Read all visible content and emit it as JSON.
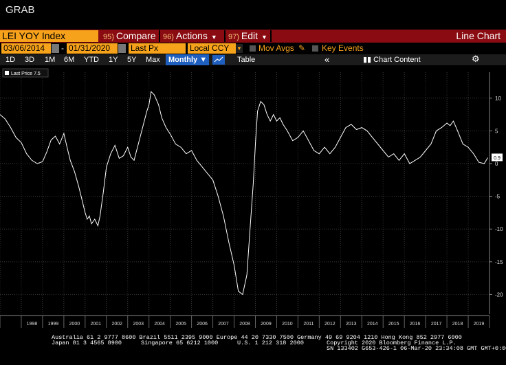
{
  "window_title": "GRAB",
  "toolbar": {
    "ticker": "LEI YOY Index",
    "compare_num": "95)",
    "compare": "Compare",
    "actions_num": "96)",
    "actions": "Actions",
    "edit_num": "97)",
    "edit": "Edit",
    "chart_type": "Line Chart"
  },
  "settings": {
    "start_date": "03/06/2014",
    "end_date": "01/31/2020",
    "dash": "-",
    "field": "Last Px",
    "currency": "Local CCY",
    "mov_avgs": "Mov Avgs",
    "key_events": "Key Events"
  },
  "periods": [
    "1D",
    "3D",
    "1M",
    "6M",
    "YTD",
    "1Y",
    "5Y",
    "Max"
  ],
  "frequency": "Monthly",
  "table_label": "Table",
  "chart_content": "Chart Content",
  "footer": {
    "line1": "Australia 61 2 9777 8600 Brazil 5511 2395 9000 Europe 44 20 7330 7500 Germany 49 69 9204 1210 Hong Kong 852 2977 6000",
    "line2a": "Japan 81 3 4565 8900",
    "line2b": "Singapore 65 6212 1000",
    "line2c": "U.S. 1 212 318 2000",
    "line2d": "Copyright 2020 Bloomberg Finance L.P.",
    "line3": "SN 133402 G653-426-1 06-Mar-20 23:34:08 GMT  GMT+0:00"
  },
  "colors": {
    "accent": "#f7a21b",
    "menu_bar": "#8a0c12",
    "line": "#ffffff",
    "background": "#000000"
  },
  "chart_data": {
    "type": "line",
    "legend": "Last Price 7.5",
    "last_value_label": "0.9",
    "xlabel": "",
    "ylabel": "",
    "ylim": [
      -23,
      12.5
    ],
    "yticks": [
      -20,
      -15,
      -10,
      -5,
      0,
      5,
      10
    ],
    "grid": true,
    "x_ticks": [
      "1998",
      "1999",
      "2000",
      "2001",
      "2002",
      "2003",
      "2004",
      "2005",
      "2006",
      "2007",
      "2008",
      "2009",
      "2010",
      "2011",
      "2012",
      "2013",
      "2014",
      "2015",
      "2016",
      "2017",
      "2018",
      "2019"
    ],
    "series": [
      {
        "x": [
          1997.0,
          1997.25,
          1997.5,
          1997.75,
          1998.0,
          1998.25,
          1998.5,
          1998.75,
          1999.0,
          1999.2,
          1999.4,
          1999.6,
          1999.8,
          2000.0,
          2000.15,
          2000.3,
          2000.5,
          2000.7,
          2000.85,
          2001.0,
          2001.1,
          2001.2,
          2001.3,
          2001.45,
          2001.6,
          2001.7,
          2001.85,
          2002.0,
          2002.2,
          2002.4,
          2002.6,
          2002.8,
          2003.0,
          2003.15,
          2003.3,
          2003.5,
          2003.7,
          2003.9,
          2004.0,
          2004.1,
          2004.25,
          2004.45,
          2004.6,
          2004.8,
          2005.0,
          2005.25,
          2005.5,
          2005.75,
          2006.0,
          2006.25,
          2006.5,
          2006.75,
          2007.0,
          2007.25,
          2007.5,
          2007.75,
          2008.0,
          2008.2,
          2008.4,
          2008.6,
          2008.75,
          2008.9,
          2009.0,
          2009.1,
          2009.25,
          2009.4,
          2009.55,
          2009.7,
          2009.85,
          2010.0,
          2010.15,
          2010.3,
          2010.5,
          2010.75,
          2011.0,
          2011.25,
          2011.5,
          2011.75,
          2012.0,
          2012.25,
          2012.5,
          2012.75,
          2013.0,
          2013.25,
          2013.5,
          2013.75,
          2014.0,
          2014.25,
          2014.5,
          2014.75,
          2015.0,
          2015.25,
          2015.5,
          2015.75,
          2016.0,
          2016.25,
          2016.5,
          2016.75,
          2017.0,
          2017.25,
          2017.5,
          2017.75,
          2018.0,
          2018.15,
          2018.3,
          2018.5,
          2018.75,
          2019.0,
          2019.25,
          2019.5,
          2019.75,
          2019.92
        ],
        "y": [
          7.5,
          6.8,
          5.5,
          4.0,
          3.2,
          1.5,
          0.5,
          0.0,
          0.3,
          1.8,
          3.6,
          4.2,
          3.0,
          4.6,
          2.5,
          0.5,
          -1.2,
          -3.5,
          -5.5,
          -7.5,
          -8.5,
          -8.0,
          -9.2,
          -8.5,
          -9.5,
          -8.0,
          -4.5,
          -0.5,
          1.5,
          2.8,
          0.8,
          1.2,
          2.5,
          1.0,
          0.5,
          3.0,
          5.5,
          8.0,
          9.0,
          11.0,
          10.5,
          9.0,
          7.0,
          5.5,
          4.5,
          3.0,
          2.5,
          1.5,
          2.0,
          0.5,
          -0.5,
          -1.5,
          -2.5,
          -5.0,
          -8.0,
          -12.0,
          -15.5,
          -19.5,
          -20.0,
          -17.0,
          -10.0,
          -3.0,
          3.0,
          8.0,
          9.5,
          9.0,
          7.5,
          6.5,
          7.5,
          6.5,
          7.0,
          6.0,
          5.0,
          3.5,
          4.0,
          5.0,
          3.5,
          2.0,
          1.5,
          2.5,
          1.5,
          2.5,
          4.0,
          5.5,
          6.0,
          5.2,
          5.5,
          5.0,
          4.0,
          3.0,
          2.0,
          1.0,
          1.5,
          0.5,
          1.5,
          0.0,
          0.5,
          1.0,
          2.0,
          3.0,
          5.0,
          5.5,
          6.2,
          5.8,
          6.5,
          5.0,
          3.0,
          2.5,
          1.5,
          0.2,
          0.0,
          0.9
        ]
      }
    ]
  }
}
